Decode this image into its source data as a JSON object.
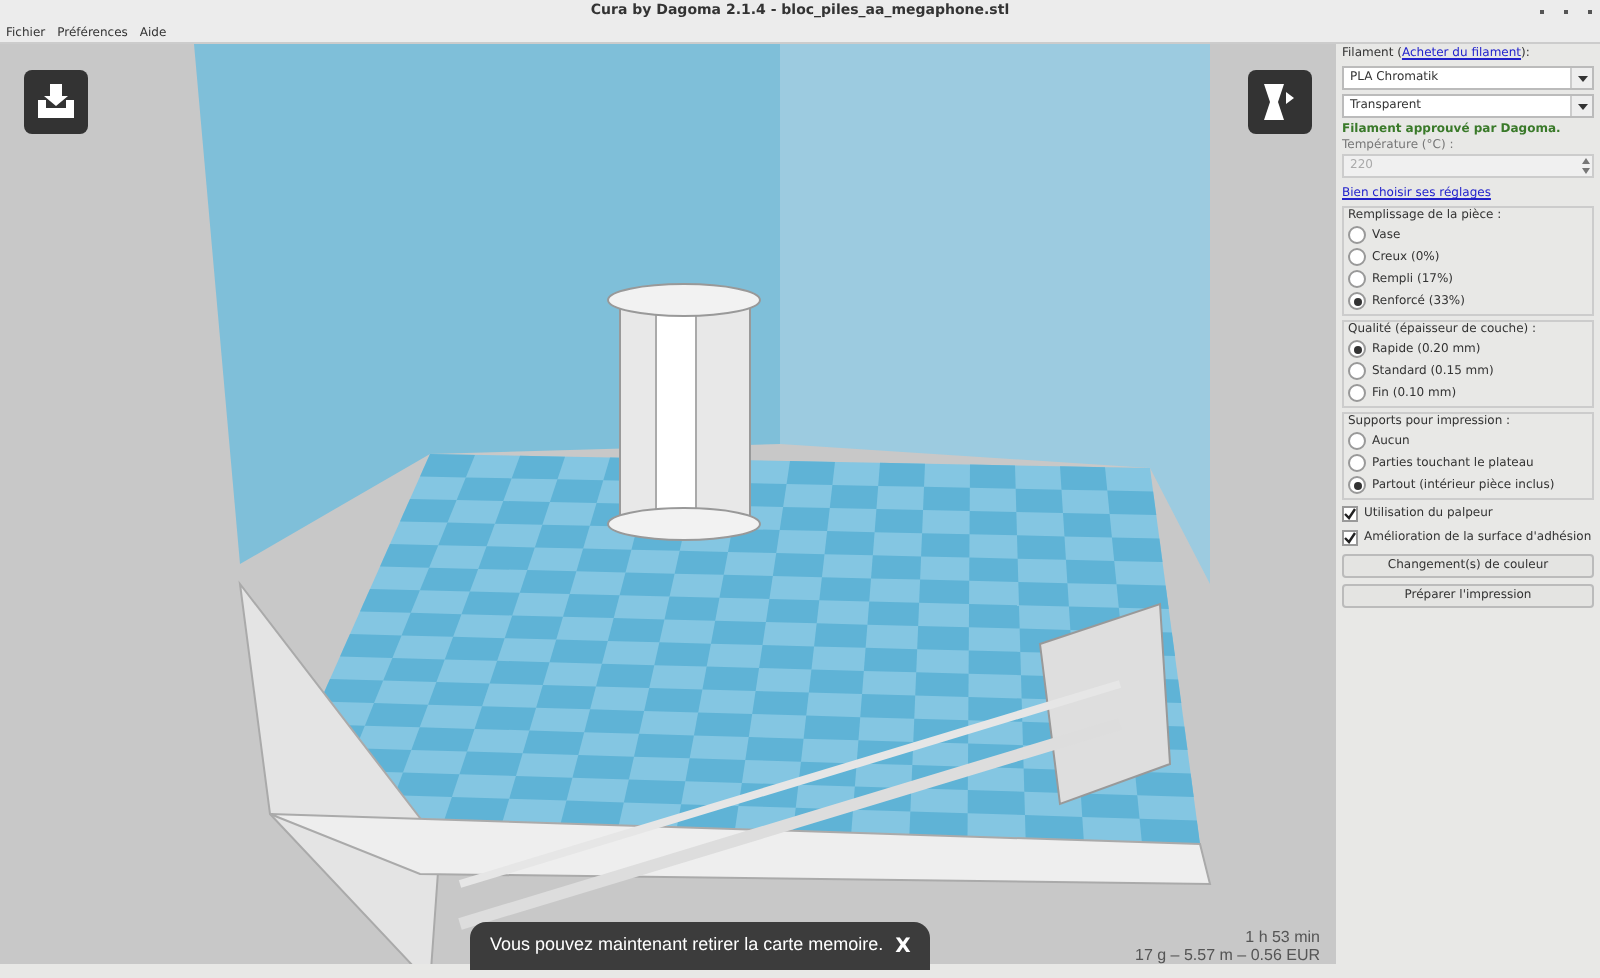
{
  "window": {
    "title": "Cura by Dagoma 2.1.4 - bloc_piles_aa_megaphone.stl"
  },
  "menu": [
    "Fichier",
    "Préférences",
    "Aide"
  ],
  "viewport": {
    "toast": {
      "message": "Vous pouvez maintenant retirer la carte memoire.",
      "close": "X"
    },
    "print_time": "1 h 53 min",
    "print_stats": "17 g – 5.57 m – 0.56 EUR"
  },
  "sidebar": {
    "filament_label": "Filament (",
    "filament_link": "Acheter du filament",
    "filament_label_end": "):",
    "filament_select": "PLA Chromatik",
    "color_select": "Transparent",
    "approved": "Filament approuvé par Dagoma.",
    "temperature_label": "Température (°C) :",
    "temperature": "220",
    "temperature_disabled": true,
    "settings_link": "Bien choisir ses réglages",
    "groups": [
      {
        "title": "Remplissage de la pièce :",
        "options": [
          {
            "label": "Vase",
            "selected": false
          },
          {
            "label": "Creux (0%)",
            "selected": false
          },
          {
            "label": "Rempli (17%)",
            "selected": false
          },
          {
            "label": "Renforcé (33%)",
            "selected": true
          }
        ]
      },
      {
        "title": "Qualité (épaisseur de couche) :",
        "options": [
          {
            "label": "Rapide (0.20 mm)",
            "selected": true
          },
          {
            "label": "Standard (0.15 mm)",
            "selected": false
          },
          {
            "label": "Fin (0.10 mm)",
            "selected": false
          }
        ]
      },
      {
        "title": "Supports pour impression :",
        "options": [
          {
            "label": "Aucun",
            "selected": false
          },
          {
            "label": "Parties touchant le plateau",
            "selected": false
          },
          {
            "label": "Partout (intérieur pièce inclus)",
            "selected": true
          }
        ]
      }
    ],
    "checkboxes": [
      {
        "label": "Utilisation du palpeur",
        "checked": true
      },
      {
        "label": "Amélioration de la surface d'adhésion",
        "checked": true
      }
    ],
    "buttons": [
      "Changement(s) de couleur",
      "Préparer l'impression"
    ]
  }
}
